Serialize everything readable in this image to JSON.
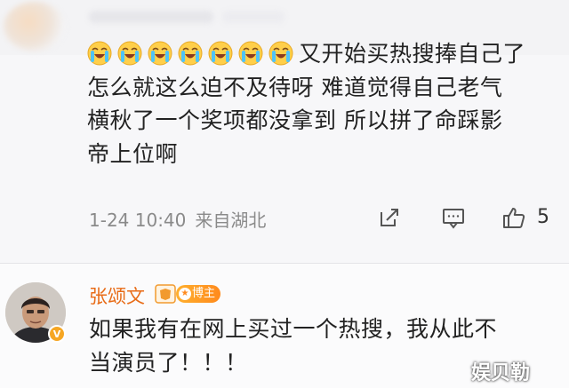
{
  "comment": {
    "emoji_name": "crying-laughing-emoji",
    "emoji_count": 7,
    "text_lines": [
      "又开始买热搜捧自己了",
      "怎么就这么迫不及待呀 难道觉得自己老气",
      "横秋了一个奖项都没拿到 所以拼了命踩影",
      "帝上位啊"
    ],
    "timestamp": "1-24 10:40",
    "location": "来自湖北",
    "share_icon": "share-icon",
    "reply_icon": "comment-icon",
    "like_icon": "thumbs-up-icon",
    "like_count": "5"
  },
  "reply": {
    "username": "张颂文",
    "vip_icon": "weibo-vip-icon",
    "badge_label": "博主",
    "verified_icon": "verified-v-icon",
    "text_lines": [
      "如果我有在网上买过一个热搜，我从此不",
      "当演员了！！！"
    ]
  },
  "watermark": "娱贝勒",
  "colors": {
    "username": "#e86b16",
    "badge": "#ff8a1d",
    "meta": "#8a8a8a",
    "text": "#222222"
  }
}
